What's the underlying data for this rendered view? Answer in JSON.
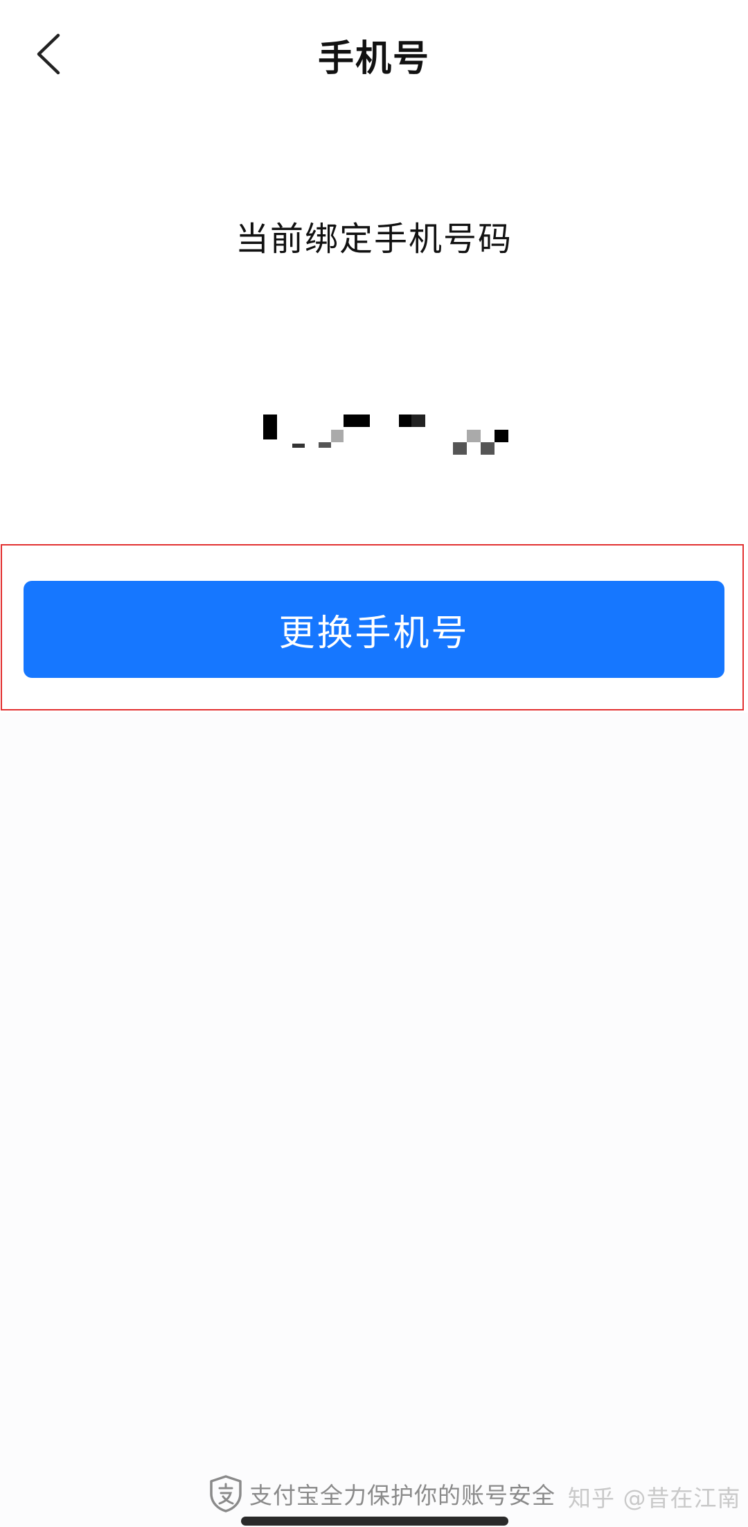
{
  "nav": {
    "back_icon": "chevron-left-icon",
    "title": "手机号"
  },
  "main": {
    "section_label": "当前绑定手机号码",
    "masked_phone_icon": "pixelated-mosaic",
    "change_button_label": "更换手机号",
    "highlight_color": "#e23030",
    "button_color": "#1677ff"
  },
  "footer": {
    "shield_icon": "alipay-shield-icon",
    "text": "支付宝全力保护你的账号安全"
  },
  "watermark": {
    "text": "知乎 @昔在江南"
  }
}
